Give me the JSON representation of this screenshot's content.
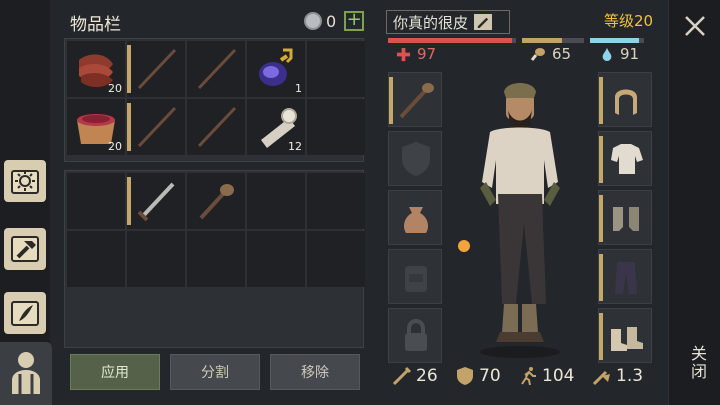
{
  "inventory": {
    "title": "物品栏",
    "coins": "0",
    "plus_label": "+",
    "slots_top": [
      {
        "icon": "meat-icon",
        "qty": "20"
      },
      {
        "icon": "stick-icon",
        "qty": ""
      },
      {
        "icon": "stick-icon",
        "qty": ""
      },
      {
        "icon": "potion-icon",
        "qty": "1"
      },
      {
        "icon": "",
        "qty": ""
      },
      {
        "icon": "berry-bowl-icon",
        "qty": "20"
      },
      {
        "icon": "stick-icon",
        "qty": ""
      },
      {
        "icon": "stick-icon",
        "qty": ""
      },
      {
        "icon": "cloth-roll-icon",
        "qty": "12"
      },
      {
        "icon": "",
        "qty": ""
      }
    ],
    "slots_bottom": [
      {
        "icon": "",
        "qty": ""
      },
      {
        "icon": "sword-icon",
        "qty": ""
      },
      {
        "icon": "mace-icon",
        "qty": ""
      }
    ],
    "buttons": {
      "apply": "应用",
      "split": "分割",
      "remove": "移除"
    }
  },
  "character": {
    "name": "你真的很皮",
    "level": "等级20",
    "health": "97",
    "hunger": "65",
    "thirst": "91",
    "health_color": "#d9534f",
    "hunger_color": "#c4a36a",
    "thirst_color": "#8fd3e8",
    "health_bar": 0.97,
    "hunger_bar": 0.65,
    "thirst_bar": 0.91,
    "attack": "26",
    "defense": "70",
    "speed": "104",
    "weight": "1.3"
  },
  "close_label": "关闭"
}
